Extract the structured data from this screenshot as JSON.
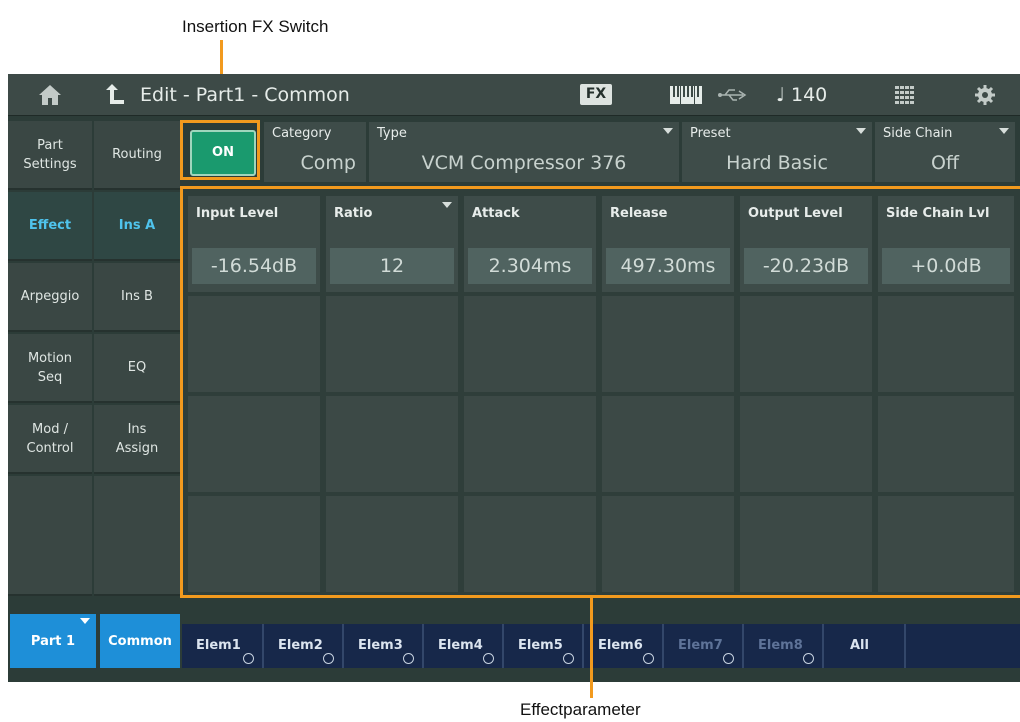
{
  "callouts": {
    "top": "Insertion FX Switch",
    "bottom": "Effectparameter"
  },
  "header": {
    "home_icon": "home-icon",
    "back_icon": "back-arrow-icon",
    "title": "Edit - Part1 - Common",
    "fx_label": "FX",
    "keyboard_icon": "keyboard-icon",
    "usb_icon": "usb-icon",
    "tempo": "♩ 140",
    "grid_icon": "grid-icon",
    "settings_icon": "gear-icon"
  },
  "left_nav": {
    "col1": [
      "Part\nSettings",
      "Effect",
      "Arpeggio",
      "Motion\nSeq",
      "Mod /\nControl",
      ""
    ],
    "col2": [
      "Routing",
      "Ins A",
      "Ins B",
      "EQ",
      "Ins\nAssign",
      ""
    ],
    "active_col1": "Effect",
    "active_col2": "Ins A"
  },
  "insertion": {
    "switch_label": "ON",
    "category": {
      "label": "Category",
      "value": "Comp"
    },
    "type": {
      "label": "Type",
      "value": "VCM Compressor 376"
    },
    "preset": {
      "label": "Preset",
      "value": "Hard Basic"
    },
    "side_chain": {
      "label": "Side Chain",
      "value": "Off"
    }
  },
  "params": [
    {
      "label": "Input Level",
      "value": "-16.54dB"
    },
    {
      "label": "Ratio",
      "value": "12"
    },
    {
      "label": "Attack",
      "value": "2.304ms"
    },
    {
      "label": "Release",
      "value": "497.30ms"
    },
    {
      "label": "Output Level",
      "value": "-20.23dB"
    },
    {
      "label": "Side Chain Lvl",
      "value": "+0.0dB"
    }
  ],
  "bottom": {
    "part": "Part 1",
    "common": "Common",
    "elements": [
      "Elem1",
      "Elem2",
      "Elem3",
      "Elem4",
      "Elem5",
      "Elem6",
      "Elem7",
      "Elem8",
      "All"
    ]
  },
  "colors": {
    "accent_orange": "#f29a1e",
    "active_blue": "#1e8fd8",
    "on_green": "#1a9a6e",
    "active_text": "#4fc3ec"
  }
}
